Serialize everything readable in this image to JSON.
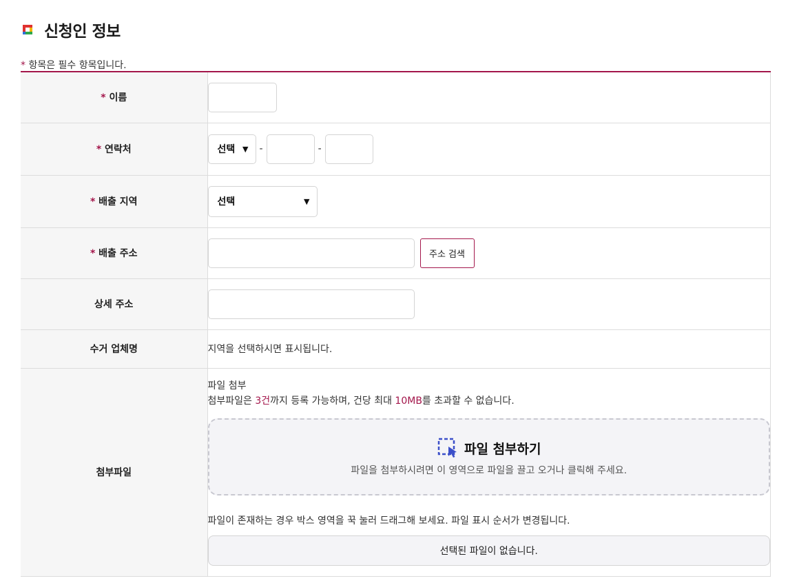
{
  "header": {
    "title": "신청인 정보",
    "logo_icon": "colored-square-logo"
  },
  "notice": {
    "mark": "*",
    "text": " 항목은 필수 항목입니다."
  },
  "colors": {
    "accent": "#a3154a",
    "label_bg": "#f6f6f6",
    "dropzone_icon": "#3b4fc9"
  },
  "form": {
    "required_mark": "*",
    "name": {
      "label": " 이름",
      "value": ""
    },
    "contact": {
      "label": " 연락처",
      "select_value": "선택",
      "separator": "-",
      "part2": "",
      "part3": ""
    },
    "region": {
      "label": " 배출 지역",
      "select_value": "선택"
    },
    "address": {
      "label": " 배출 주소",
      "value": "",
      "search_button": "주소 검색"
    },
    "detail_address": {
      "label": "상세 주소",
      "value": ""
    },
    "company": {
      "label": "수거 업체명",
      "text": "지역을 선택하시면 표시됩니다."
    },
    "attachment": {
      "label": "첨부파일",
      "heading": "파일 첨부",
      "limit_prefix": "첨부파일은 ",
      "limit_count": "3건",
      "limit_middle": "까지 등록 가능하며, 건당 최대 ",
      "limit_size": "10MB",
      "limit_suffix": "를 초과할 수 없습니다.",
      "dropzone_title": "파일 첨부하기",
      "dropzone_desc": "파일을 첨부하시려면 이 영역으로 파일을 끌고 오거나 클릭해 주세요.",
      "drag_hint": "파일이 존재하는 경우 박스 영역을 꾹 눌러 드래그해 보세요. 파일 표시 순서가 변경됩니다.",
      "empty_text": "선택된 파일이 없습니다."
    }
  }
}
